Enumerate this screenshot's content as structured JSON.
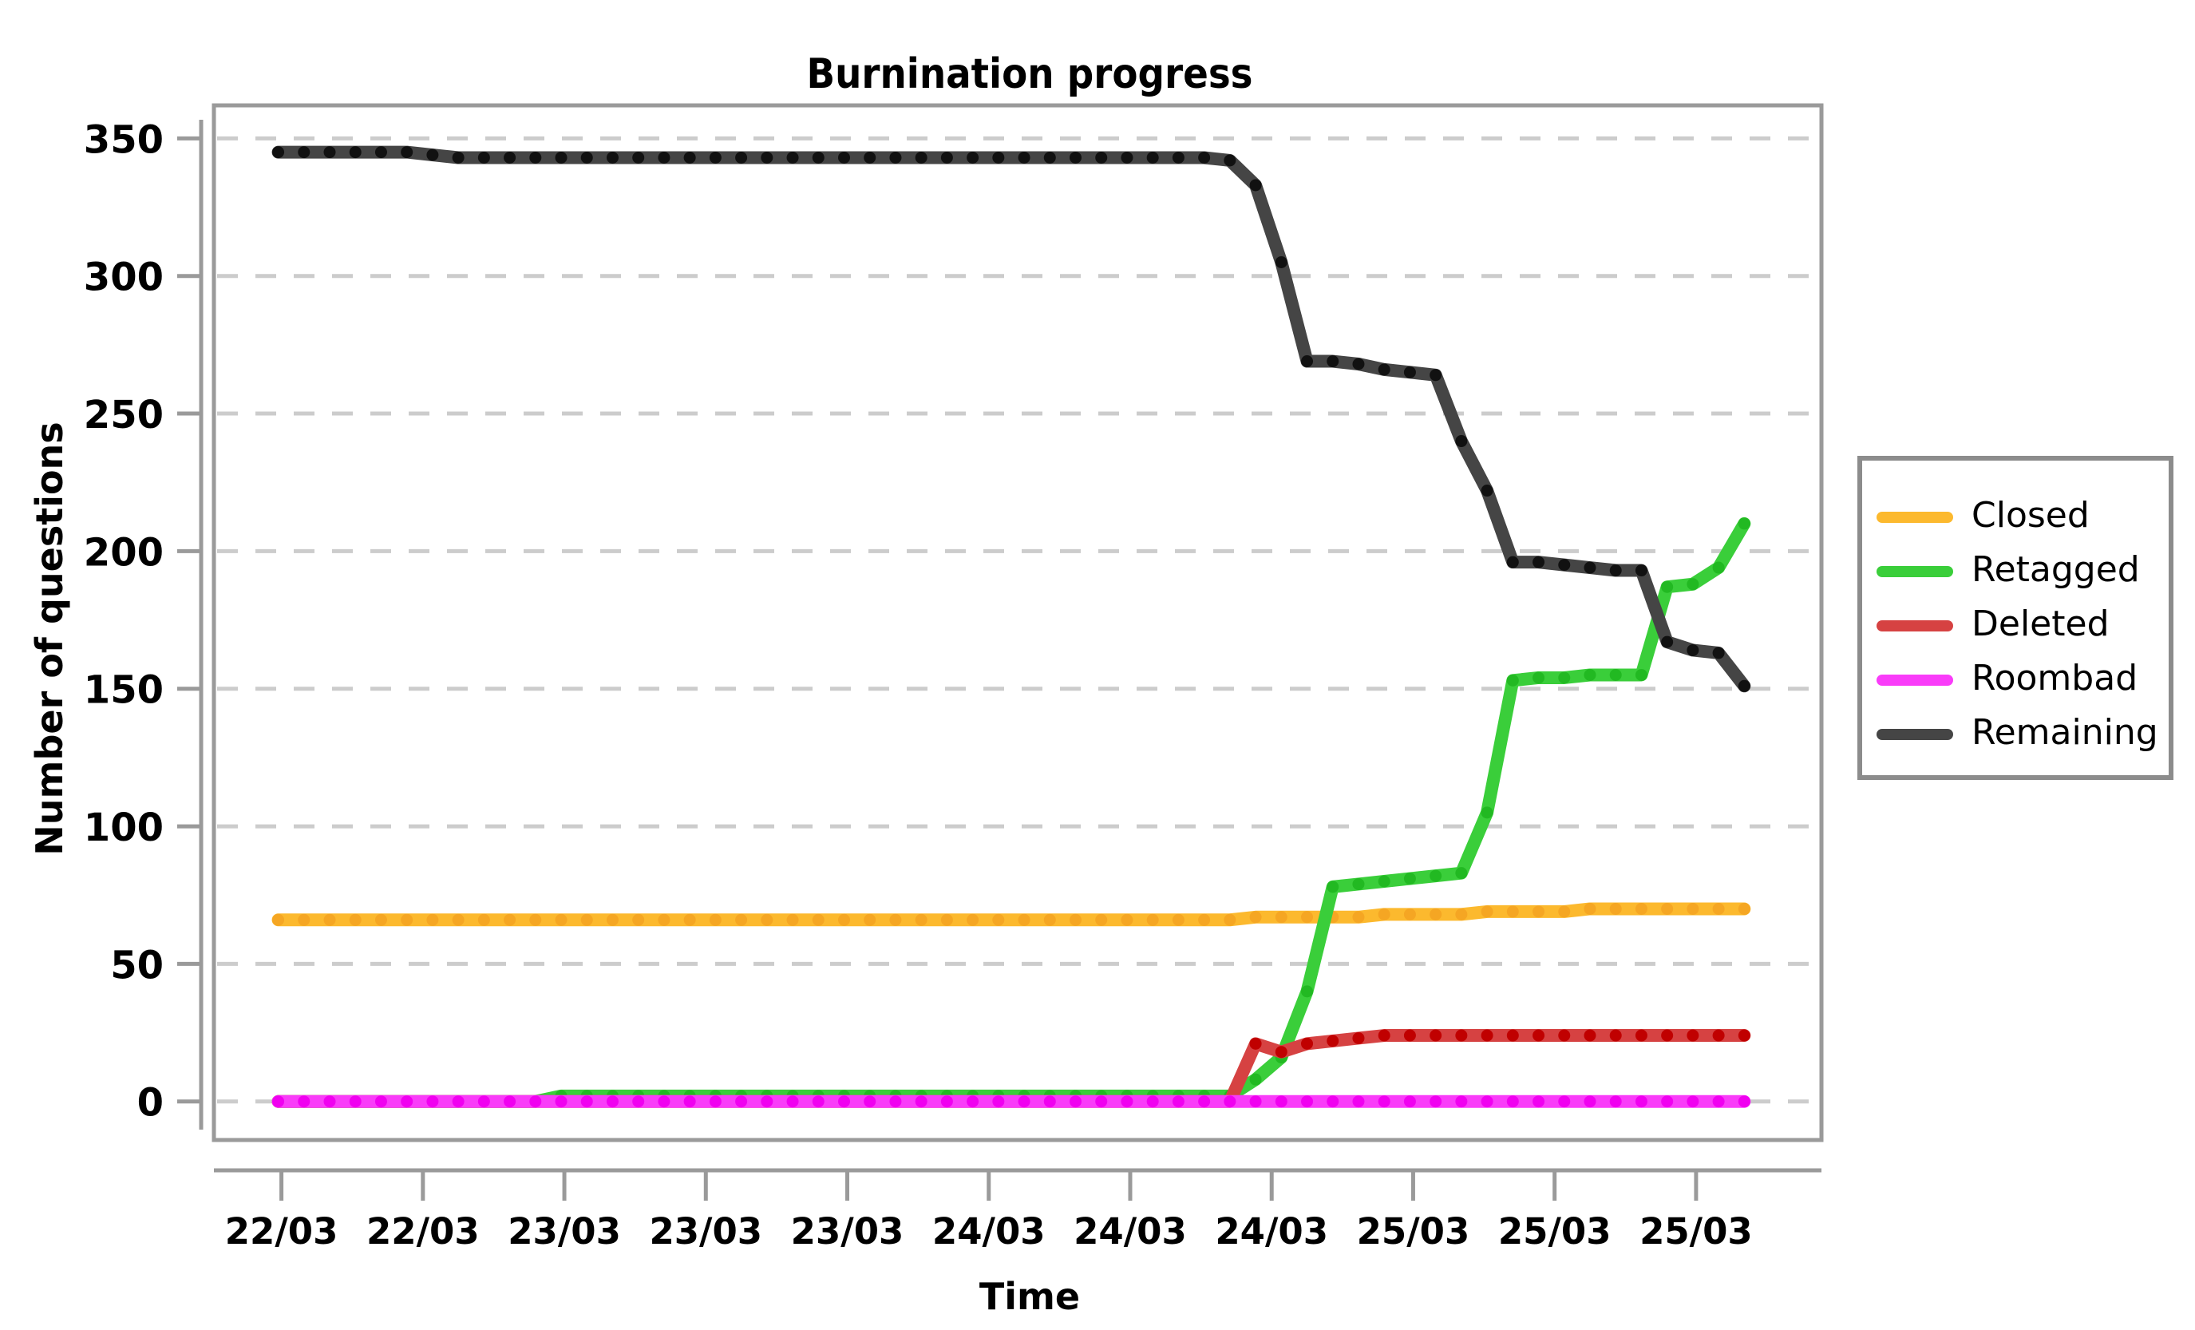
{
  "chart_data": {
    "type": "line",
    "title": "Burnination progress",
    "xlabel": "Time",
    "ylabel": "Number of questions",
    "ylim": [
      -14,
      362
    ],
    "yticks": [
      0,
      50,
      100,
      150,
      200,
      250,
      300,
      350
    ],
    "ytick_labels": [
      "0",
      "50",
      "100",
      "150",
      "200",
      "250",
      "300",
      "350"
    ],
    "xlim": [
      0,
      100
    ],
    "xticks": [
      4.2,
      13.0,
      21.8,
      30.6,
      39.4,
      48.2,
      57.0,
      65.8,
      74.6,
      83.4,
      92.2
    ],
    "xtick_labels": [
      "22/03",
      "22/03",
      "23/03",
      "23/03",
      "23/03",
      "24/03",
      "24/03",
      "24/03",
      "25/03",
      "25/03",
      "25/03"
    ],
    "grid": true,
    "grid_axis": "y",
    "legend_position": "center right outside",
    "marker": "point",
    "series": [
      {
        "name": "Closed",
        "color": "#FCB92E",
        "marker_color": "#F5A623",
        "x": [
          4.0,
          5.6,
          7.2,
          8.8,
          10.4,
          12.0,
          13.6,
          15.2,
          16.8,
          18.4,
          20.0,
          21.6,
          23.2,
          24.8,
          26.4,
          28.0,
          29.6,
          31.2,
          32.8,
          34.4,
          36.0,
          37.6,
          39.2,
          40.8,
          42.4,
          44.0,
          45.6,
          47.2,
          48.8,
          50.4,
          52.0,
          53.6,
          55.2,
          56.8,
          58.4,
          60.0,
          61.6,
          63.2,
          64.8,
          66.4,
          68.0,
          69.6,
          71.2,
          72.8,
          74.4,
          76.0,
          77.6,
          79.2,
          80.8,
          82.4,
          84.0,
          85.6,
          87.2,
          88.8,
          90.4,
          92.0,
          93.6,
          95.2
        ],
        "y": [
          66,
          66,
          66,
          66,
          66,
          66,
          66,
          66,
          66,
          66,
          66,
          66,
          66,
          66,
          66,
          66,
          66,
          66,
          66,
          66,
          66,
          66,
          66,
          66,
          66,
          66,
          66,
          66,
          66,
          66,
          66,
          66,
          66,
          66,
          66,
          66,
          66,
          66,
          67,
          67,
          67,
          67,
          67,
          68,
          68,
          68,
          68,
          69,
          69,
          69,
          69,
          70,
          70,
          70,
          70,
          70,
          70,
          70
        ]
      },
      {
        "name": "Retagged",
        "color": "#3ACE3A",
        "marker_color": "#22B922",
        "x": [
          4.0,
          5.6,
          7.2,
          8.8,
          10.4,
          12.0,
          13.6,
          15.2,
          16.8,
          18.4,
          20.0,
          21.6,
          23.2,
          24.8,
          26.4,
          28.0,
          29.6,
          31.2,
          32.8,
          34.4,
          36.0,
          37.6,
          39.2,
          40.8,
          42.4,
          44.0,
          45.6,
          47.2,
          48.8,
          50.4,
          52.0,
          53.6,
          55.2,
          56.8,
          58.4,
          60.0,
          61.6,
          63.2,
          64.8,
          66.4,
          68.0,
          69.6,
          71.2,
          72.8,
          74.4,
          76.0,
          77.6,
          79.2,
          80.8,
          82.4,
          84.0,
          85.6,
          87.2,
          88.8,
          90.4,
          92.0,
          93.6,
          95.2
        ],
        "y": [
          0,
          0,
          0,
          0,
          0,
          0,
          0,
          0,
          0,
          0,
          0,
          2,
          2,
          2,
          2,
          2,
          2,
          2,
          2,
          2,
          2,
          2,
          2,
          2,
          2,
          2,
          2,
          2,
          2,
          2,
          2,
          2,
          2,
          2,
          2,
          2,
          2,
          2,
          8,
          16,
          40,
          78,
          79,
          80,
          81,
          82,
          83,
          105,
          153,
          154,
          154,
          155,
          155,
          155,
          187,
          188,
          194,
          210
        ]
      },
      {
        "name": "Deleted",
        "color": "#D64242",
        "marker_color": "#C00000",
        "x": [
          4.0,
          5.6,
          7.2,
          8.8,
          10.4,
          12.0,
          13.6,
          15.2,
          16.8,
          18.4,
          20.0,
          21.6,
          23.2,
          24.8,
          26.4,
          28.0,
          29.6,
          31.2,
          32.8,
          34.4,
          36.0,
          37.6,
          39.2,
          40.8,
          42.4,
          44.0,
          45.6,
          47.2,
          48.8,
          50.4,
          52.0,
          53.6,
          55.2,
          56.8,
          58.4,
          60.0,
          61.6,
          63.2,
          64.8,
          66.4,
          68.0,
          69.6,
          71.2,
          72.8,
          74.4,
          76.0,
          77.6,
          79.2,
          80.8,
          82.4,
          84.0,
          85.6,
          87.2,
          88.8,
          90.4,
          92.0,
          93.6,
          95.2
        ],
        "y": [
          0,
          0,
          0,
          0,
          0,
          0,
          0,
          0,
          0,
          0,
          0,
          0,
          0,
          0,
          0,
          0,
          0,
          0,
          0,
          0,
          0,
          0,
          0,
          0,
          0,
          0,
          0,
          0,
          0,
          0,
          0,
          0,
          0,
          0,
          0,
          0,
          0,
          0,
          21,
          18,
          21,
          22,
          23,
          24,
          24,
          24,
          24,
          24,
          24,
          24,
          24,
          24,
          24,
          24,
          24,
          24,
          24,
          24
        ]
      },
      {
        "name": "Roombad",
        "color": "#F93CF9",
        "marker_color": "#F000F0",
        "x": [
          4.0,
          5.6,
          7.2,
          8.8,
          10.4,
          12.0,
          13.6,
          15.2,
          16.8,
          18.4,
          20.0,
          21.6,
          23.2,
          24.8,
          26.4,
          28.0,
          29.6,
          31.2,
          32.8,
          34.4,
          36.0,
          37.6,
          39.2,
          40.8,
          42.4,
          44.0,
          45.6,
          47.2,
          48.8,
          50.4,
          52.0,
          53.6,
          55.2,
          56.8,
          58.4,
          60.0,
          61.6,
          63.2,
          64.8,
          66.4,
          68.0,
          69.6,
          71.2,
          72.8,
          74.4,
          76.0,
          77.6,
          79.2,
          80.8,
          82.4,
          84.0,
          85.6,
          87.2,
          88.8,
          90.4,
          92.0,
          93.6,
          95.2
        ],
        "y": [
          0,
          0,
          0,
          0,
          0,
          0,
          0,
          0,
          0,
          0,
          0,
          0,
          0,
          0,
          0,
          0,
          0,
          0,
          0,
          0,
          0,
          0,
          0,
          0,
          0,
          0,
          0,
          0,
          0,
          0,
          0,
          0,
          0,
          0,
          0,
          0,
          0,
          0,
          0,
          0,
          0,
          0,
          0,
          0,
          0,
          0,
          0,
          0,
          0,
          0,
          0,
          0,
          0,
          0,
          0,
          0,
          0,
          0
        ]
      },
      {
        "name": "Remaining",
        "color": "#454545",
        "marker_color": "#111111",
        "x": [
          4.0,
          5.6,
          7.2,
          8.8,
          10.4,
          12.0,
          13.6,
          15.2,
          16.8,
          18.4,
          20.0,
          21.6,
          23.2,
          24.8,
          26.4,
          28.0,
          29.6,
          31.2,
          32.8,
          34.4,
          36.0,
          37.6,
          39.2,
          40.8,
          42.4,
          44.0,
          45.6,
          47.2,
          48.8,
          50.4,
          52.0,
          53.6,
          55.2,
          56.8,
          58.4,
          60.0,
          61.6,
          63.2,
          64.8,
          66.4,
          68.0,
          69.6,
          71.2,
          72.8,
          74.4,
          76.0,
          77.6,
          79.2,
          80.8,
          82.4,
          84.0,
          85.6,
          87.2,
          88.8,
          90.4,
          92.0,
          93.6,
          95.2
        ],
        "y": [
          345,
          345,
          345,
          345,
          345,
          345,
          344,
          343,
          343,
          343,
          343,
          343,
          343,
          343,
          343,
          343,
          343,
          343,
          343,
          343,
          343,
          343,
          343,
          343,
          343,
          343,
          343,
          343,
          343,
          343,
          343,
          343,
          343,
          343,
          343,
          343,
          343,
          342,
          333,
          305,
          269,
          269,
          268,
          266,
          265,
          264,
          240,
          222,
          196,
          196,
          195,
          194,
          193,
          193,
          167,
          164,
          163,
          151
        ]
      }
    ]
  },
  "legend": {
    "entries": [
      {
        "label": "Closed",
        "color": "#FCB92E"
      },
      {
        "label": "Retagged",
        "color": "#3ACE3A"
      },
      {
        "label": "Deleted",
        "color": "#D64242"
      },
      {
        "label": "Roombad",
        "color": "#F93CF9"
      },
      {
        "label": "Remaining",
        "color": "#454545"
      }
    ]
  },
  "colors": {
    "background": "#FFFFFF",
    "axis": "#9A9A9A",
    "grid": "#CCCCCC",
    "text": "#000000",
    "closed": "#FCB92E",
    "retagged": "#3ACE3A",
    "deleted": "#D64242",
    "roombad": "#F93CF9",
    "remaining": "#454545"
  }
}
